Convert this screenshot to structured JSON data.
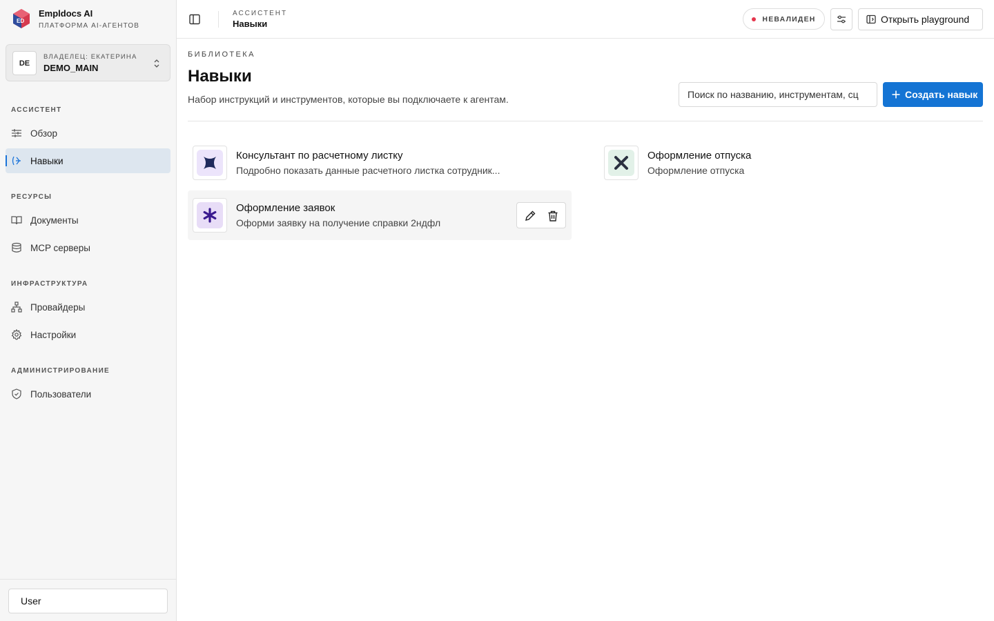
{
  "brand": {
    "name": "Empldocs AI",
    "subtitle": "ПЛАТФОРМА AI-АГЕНТОВ",
    "logo_text": "ED"
  },
  "workspace": {
    "avatar": "DE",
    "owner": "ВЛАДЕЛЕЦ: ЕКАТЕРИНА",
    "name": "DEMO_MAIN"
  },
  "sidebar": {
    "sections": [
      {
        "title": "АССИСТЕНТ",
        "items": [
          {
            "label": "Обзор",
            "icon": "sliders-icon"
          },
          {
            "label": "Навыки",
            "icon": "skill-icon",
            "active": true
          }
        ]
      },
      {
        "title": "РЕСУРСЫ",
        "items": [
          {
            "label": "Документы",
            "icon": "book-icon"
          },
          {
            "label": "MCP серверы",
            "icon": "database-icon"
          }
        ]
      },
      {
        "title": "ИНФРАСТРУКТУРА",
        "items": [
          {
            "label": "Провайдеры",
            "icon": "network-icon"
          },
          {
            "label": "Настройки",
            "icon": "gear-icon"
          }
        ]
      },
      {
        "title": "АДМИНИСТРИРОВАНИЕ",
        "items": [
          {
            "label": "Пользователи",
            "icon": "shield-icon"
          }
        ]
      }
    ],
    "user_field": "User"
  },
  "header": {
    "breadcrumb_top": "АССИСТЕНТ",
    "breadcrumb_main": "Навыки",
    "status": "НЕВАЛИДЕН",
    "status_color": "#e5364d",
    "playground_label": "Открыть playground"
  },
  "main": {
    "section_label": "БИБЛИОТЕКА",
    "title": "Навыки",
    "description": "Набор инструкций и инструментов, которые вы подключаете к агентам.",
    "search_placeholder": "Поиск по названию, инструментам, сц",
    "create_label": "Создать навык",
    "accent_color": "#1474d4"
  },
  "skills": [
    {
      "title": "Консультант по расчетному листку",
      "description": "Подробно показать данные расчетного листка сотрудник...",
      "icon": "x-shape-icon",
      "icon_bg": "#ece4fb",
      "icon_color": "#1f2a5c"
    },
    {
      "title": "Оформление отпуска",
      "description": "Оформление отпуска",
      "icon": "x-icon",
      "icon_bg": "#e2f1e8",
      "icon_color": "#2b3040"
    },
    {
      "title": "Оформление заявок",
      "description": "Оформи заявку на получение справки 2ндфл",
      "icon": "asterisk-icon",
      "icon_bg": "#e8ddf7",
      "icon_color": "#3a1a8f"
    }
  ]
}
